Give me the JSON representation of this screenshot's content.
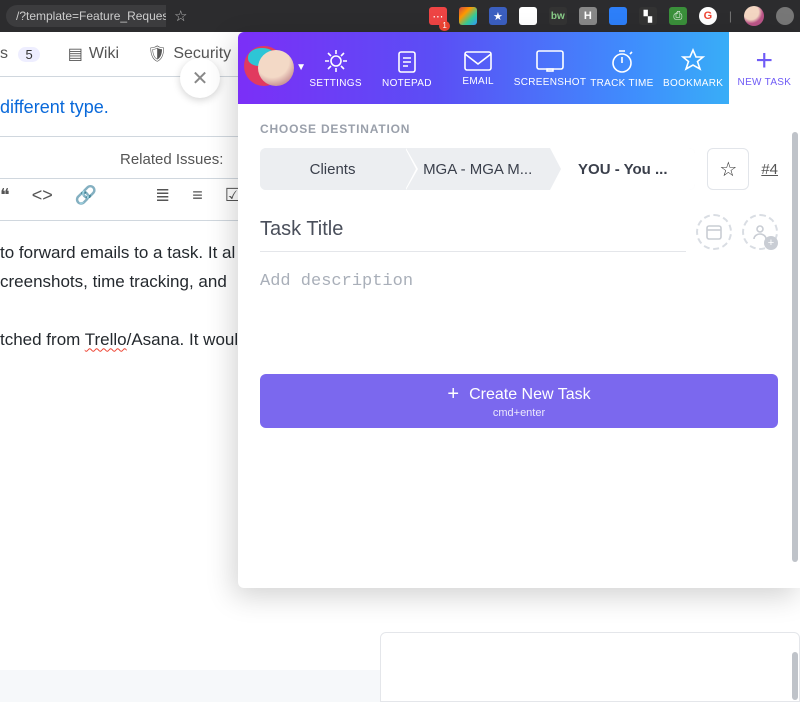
{
  "browser": {
    "url_fragment": "/?template=Feature_Request.md",
    "badge_1": "1"
  },
  "page": {
    "tab_issues_count": "5",
    "tab_wiki": "Wiki",
    "tab_security": "Security",
    "blue_line": "different type.",
    "related_label": "Related Issues:",
    "para1a": " to forward emails to a task. It al",
    "para1b": "creenshots, time tracking, and",
    "para2a": "tched from ",
    "para2_trello": "Trello",
    "para2b": "/Asana. It would be great"
  },
  "panel": {
    "tabs": {
      "settings": "SETTINGS",
      "notepad": "NOTEPAD",
      "email": "EMAIL",
      "screenshot": "SCREENSHOT",
      "tracktime": "TRACK TIME",
      "bookmark": "BOOKMARK",
      "newtask": "NEW TASK"
    },
    "choose_label": "CHOOSE DESTINATION",
    "crumbs": {
      "c1": "Clients",
      "c2": "MGA - MGA M...",
      "c3": "YOU - You ..."
    },
    "task_number": "#4",
    "title_placeholder": "Task Title",
    "desc_placeholder": "Add description",
    "create_label": "Create New Task",
    "create_sub": "cmd+enter"
  }
}
